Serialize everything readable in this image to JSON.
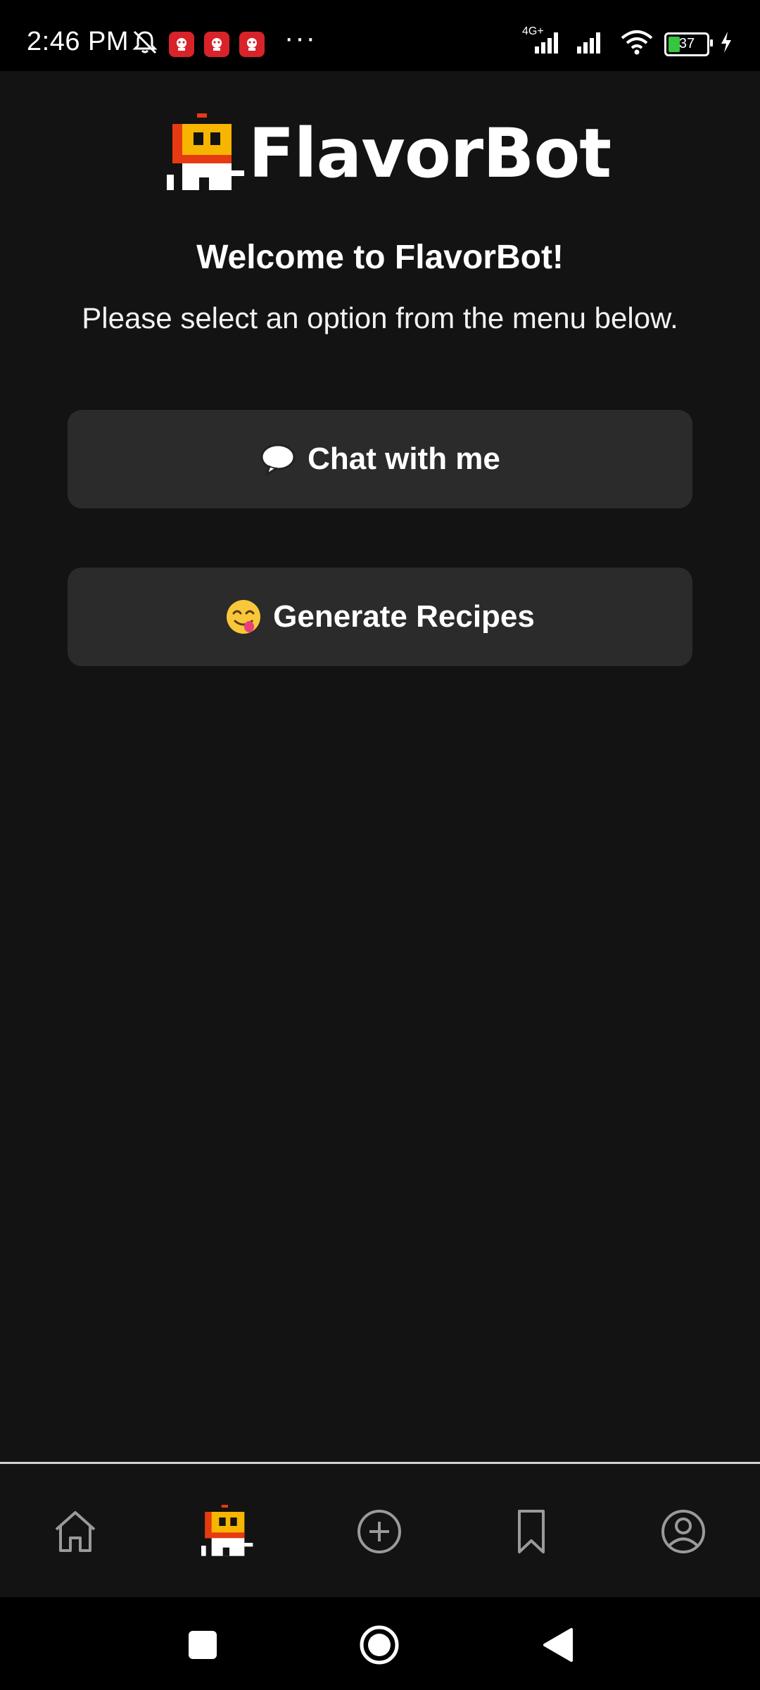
{
  "status_bar": {
    "time": "2:46 PM",
    "network_label": "4G+",
    "battery_level": "37",
    "icons": [
      "mute-icon",
      "app-notification-icon",
      "app-notification-icon",
      "app-notification-icon",
      "more-dots-icon",
      "signal-icon",
      "signal-icon",
      "wifi-icon",
      "battery-icon",
      "charging-icon"
    ]
  },
  "header": {
    "app_name": "FlavorBot",
    "welcome": "Welcome to FlavorBot!",
    "subtitle": "Please select an option from the menu below."
  },
  "menu": {
    "chat_label": "Chat with me",
    "chat_icon": "speech-bubble-icon",
    "recipes_label": "Generate Recipes",
    "recipes_icon": "yum-face-icon"
  },
  "bottom_nav": {
    "items": [
      "home-icon",
      "flavorbot-icon",
      "add-circle-icon",
      "bookmark-icon",
      "profile-icon"
    ],
    "active": "flavorbot-icon"
  },
  "system_nav": [
    "recents-icon",
    "home-circle-icon",
    "back-icon"
  ],
  "colors": {
    "background": "#131313",
    "button": "#2b2b2b",
    "logo_yellow": "#f7b500",
    "logo_red": "#e53a12"
  }
}
